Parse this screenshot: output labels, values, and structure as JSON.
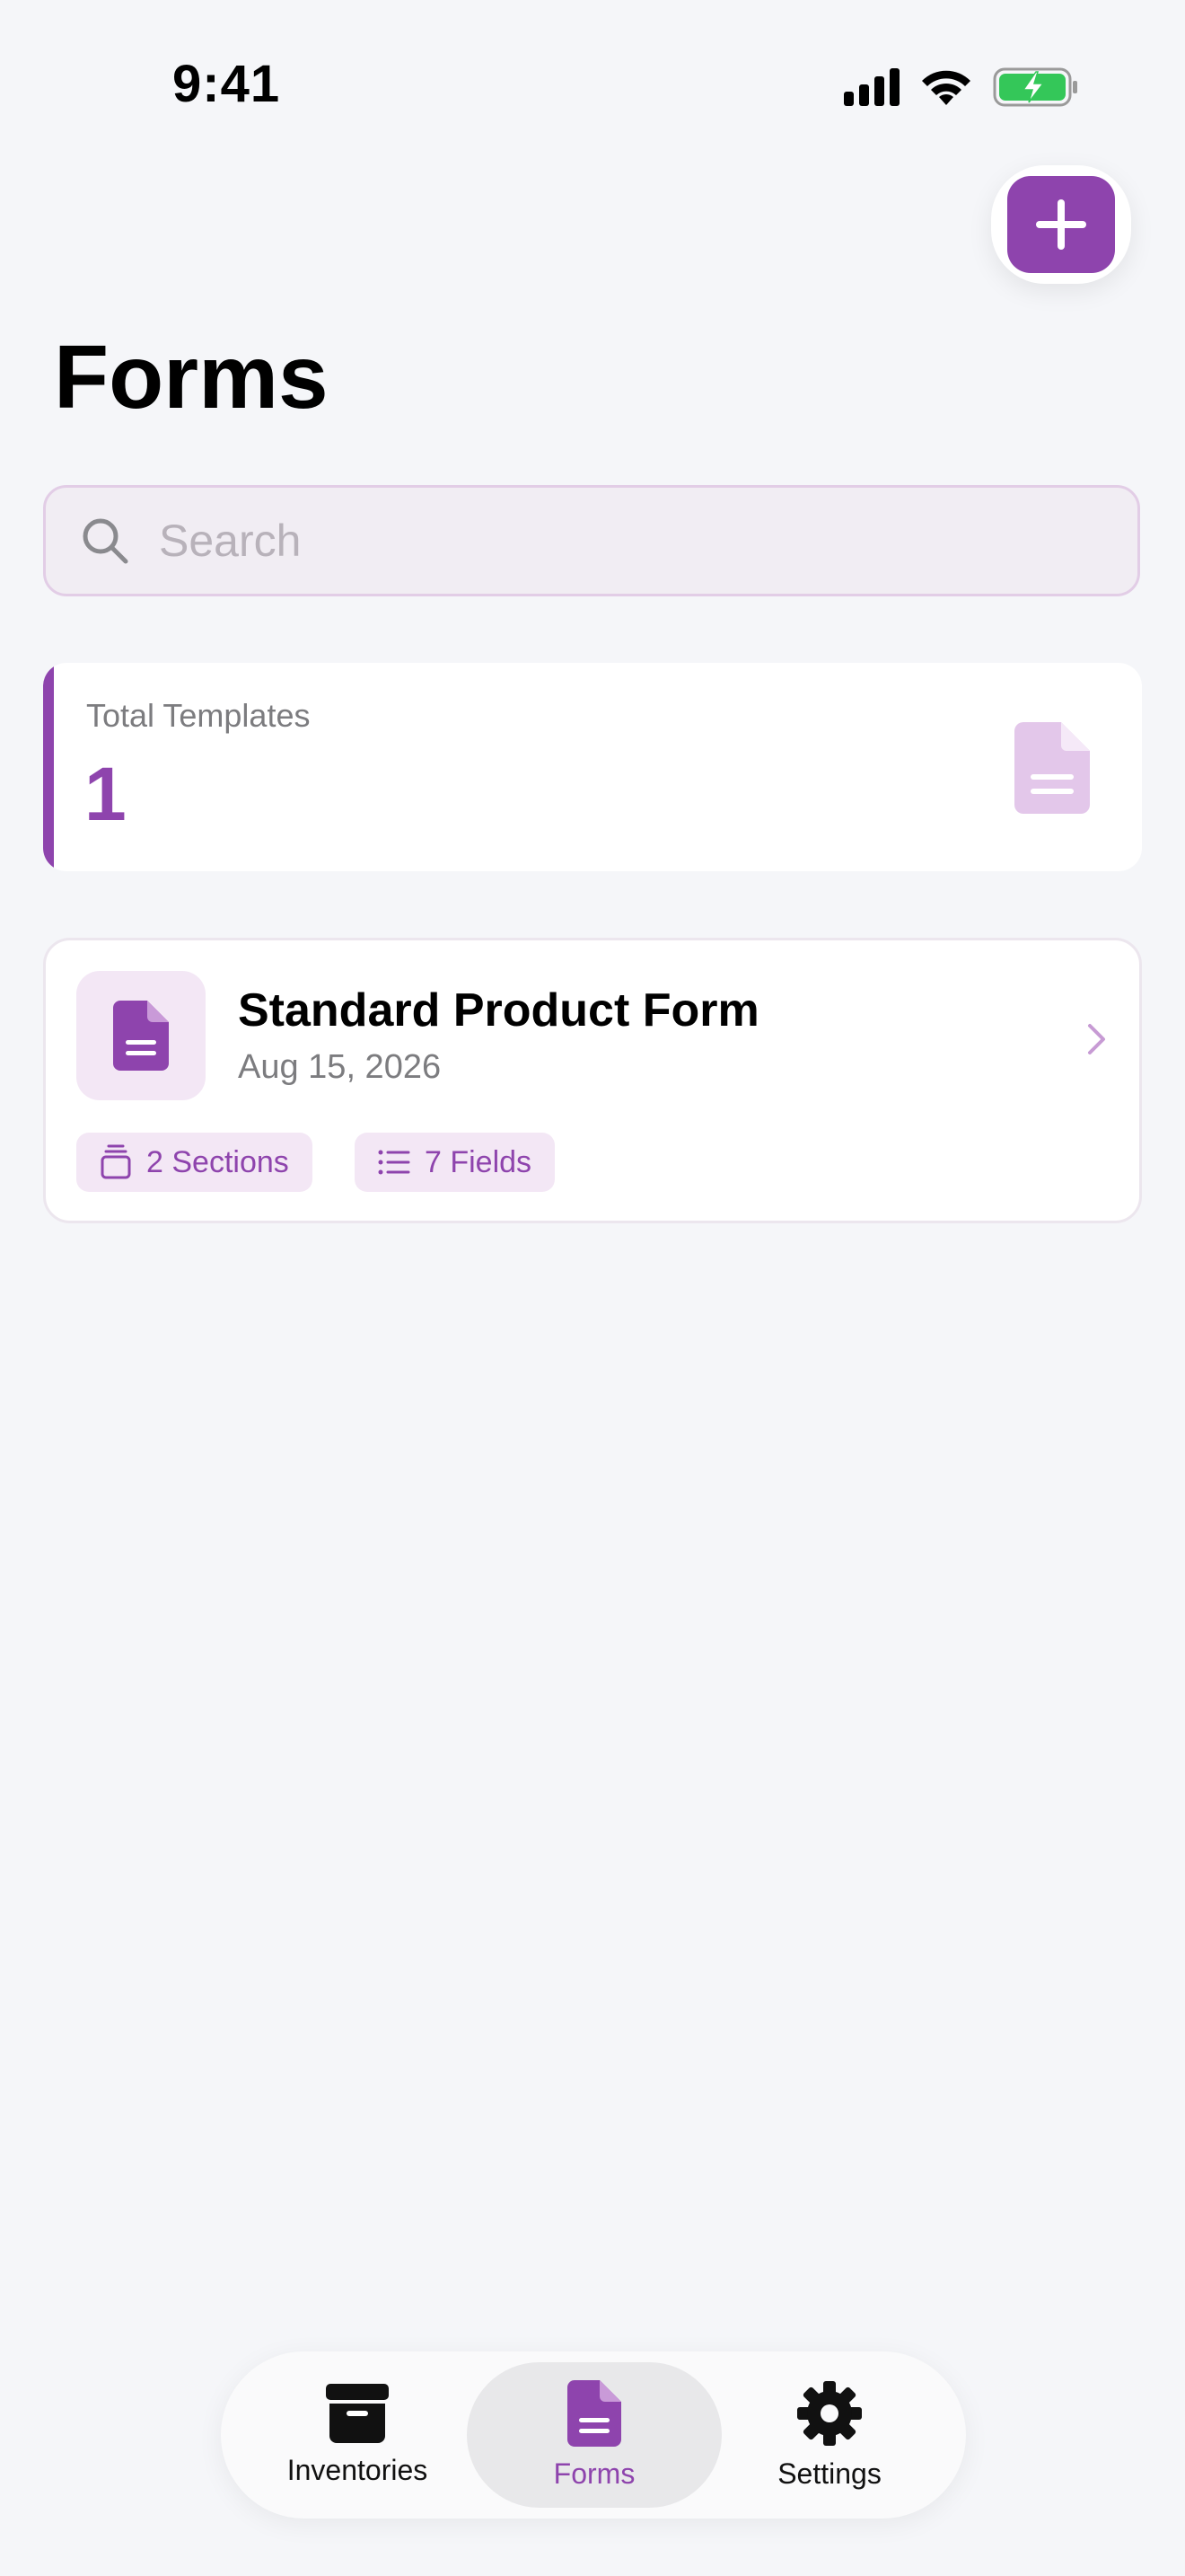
{
  "status_bar": {
    "time": "9:41"
  },
  "header": {
    "title": "Forms",
    "add_icon": "plus-icon"
  },
  "search": {
    "placeholder": "Search",
    "value": ""
  },
  "stats": {
    "label": "Total Templates",
    "value": "1",
    "icon": "document-icon"
  },
  "forms": [
    {
      "title": "Standard Product Form",
      "date": "Aug 15, 2026",
      "sections": "2 Sections",
      "fields": "7 Fields"
    }
  ],
  "tabs": [
    {
      "label": "Inventories",
      "icon": "archive-box-icon",
      "active": false
    },
    {
      "label": "Forms",
      "icon": "document-icon",
      "active": true
    },
    {
      "label": "Settings",
      "icon": "gear-icon",
      "active": false
    }
  ],
  "colors": {
    "accent": "#8e44ad",
    "accent_light": "#f3e7f5",
    "background": "#f5f6f9",
    "battery": "#34c759"
  }
}
